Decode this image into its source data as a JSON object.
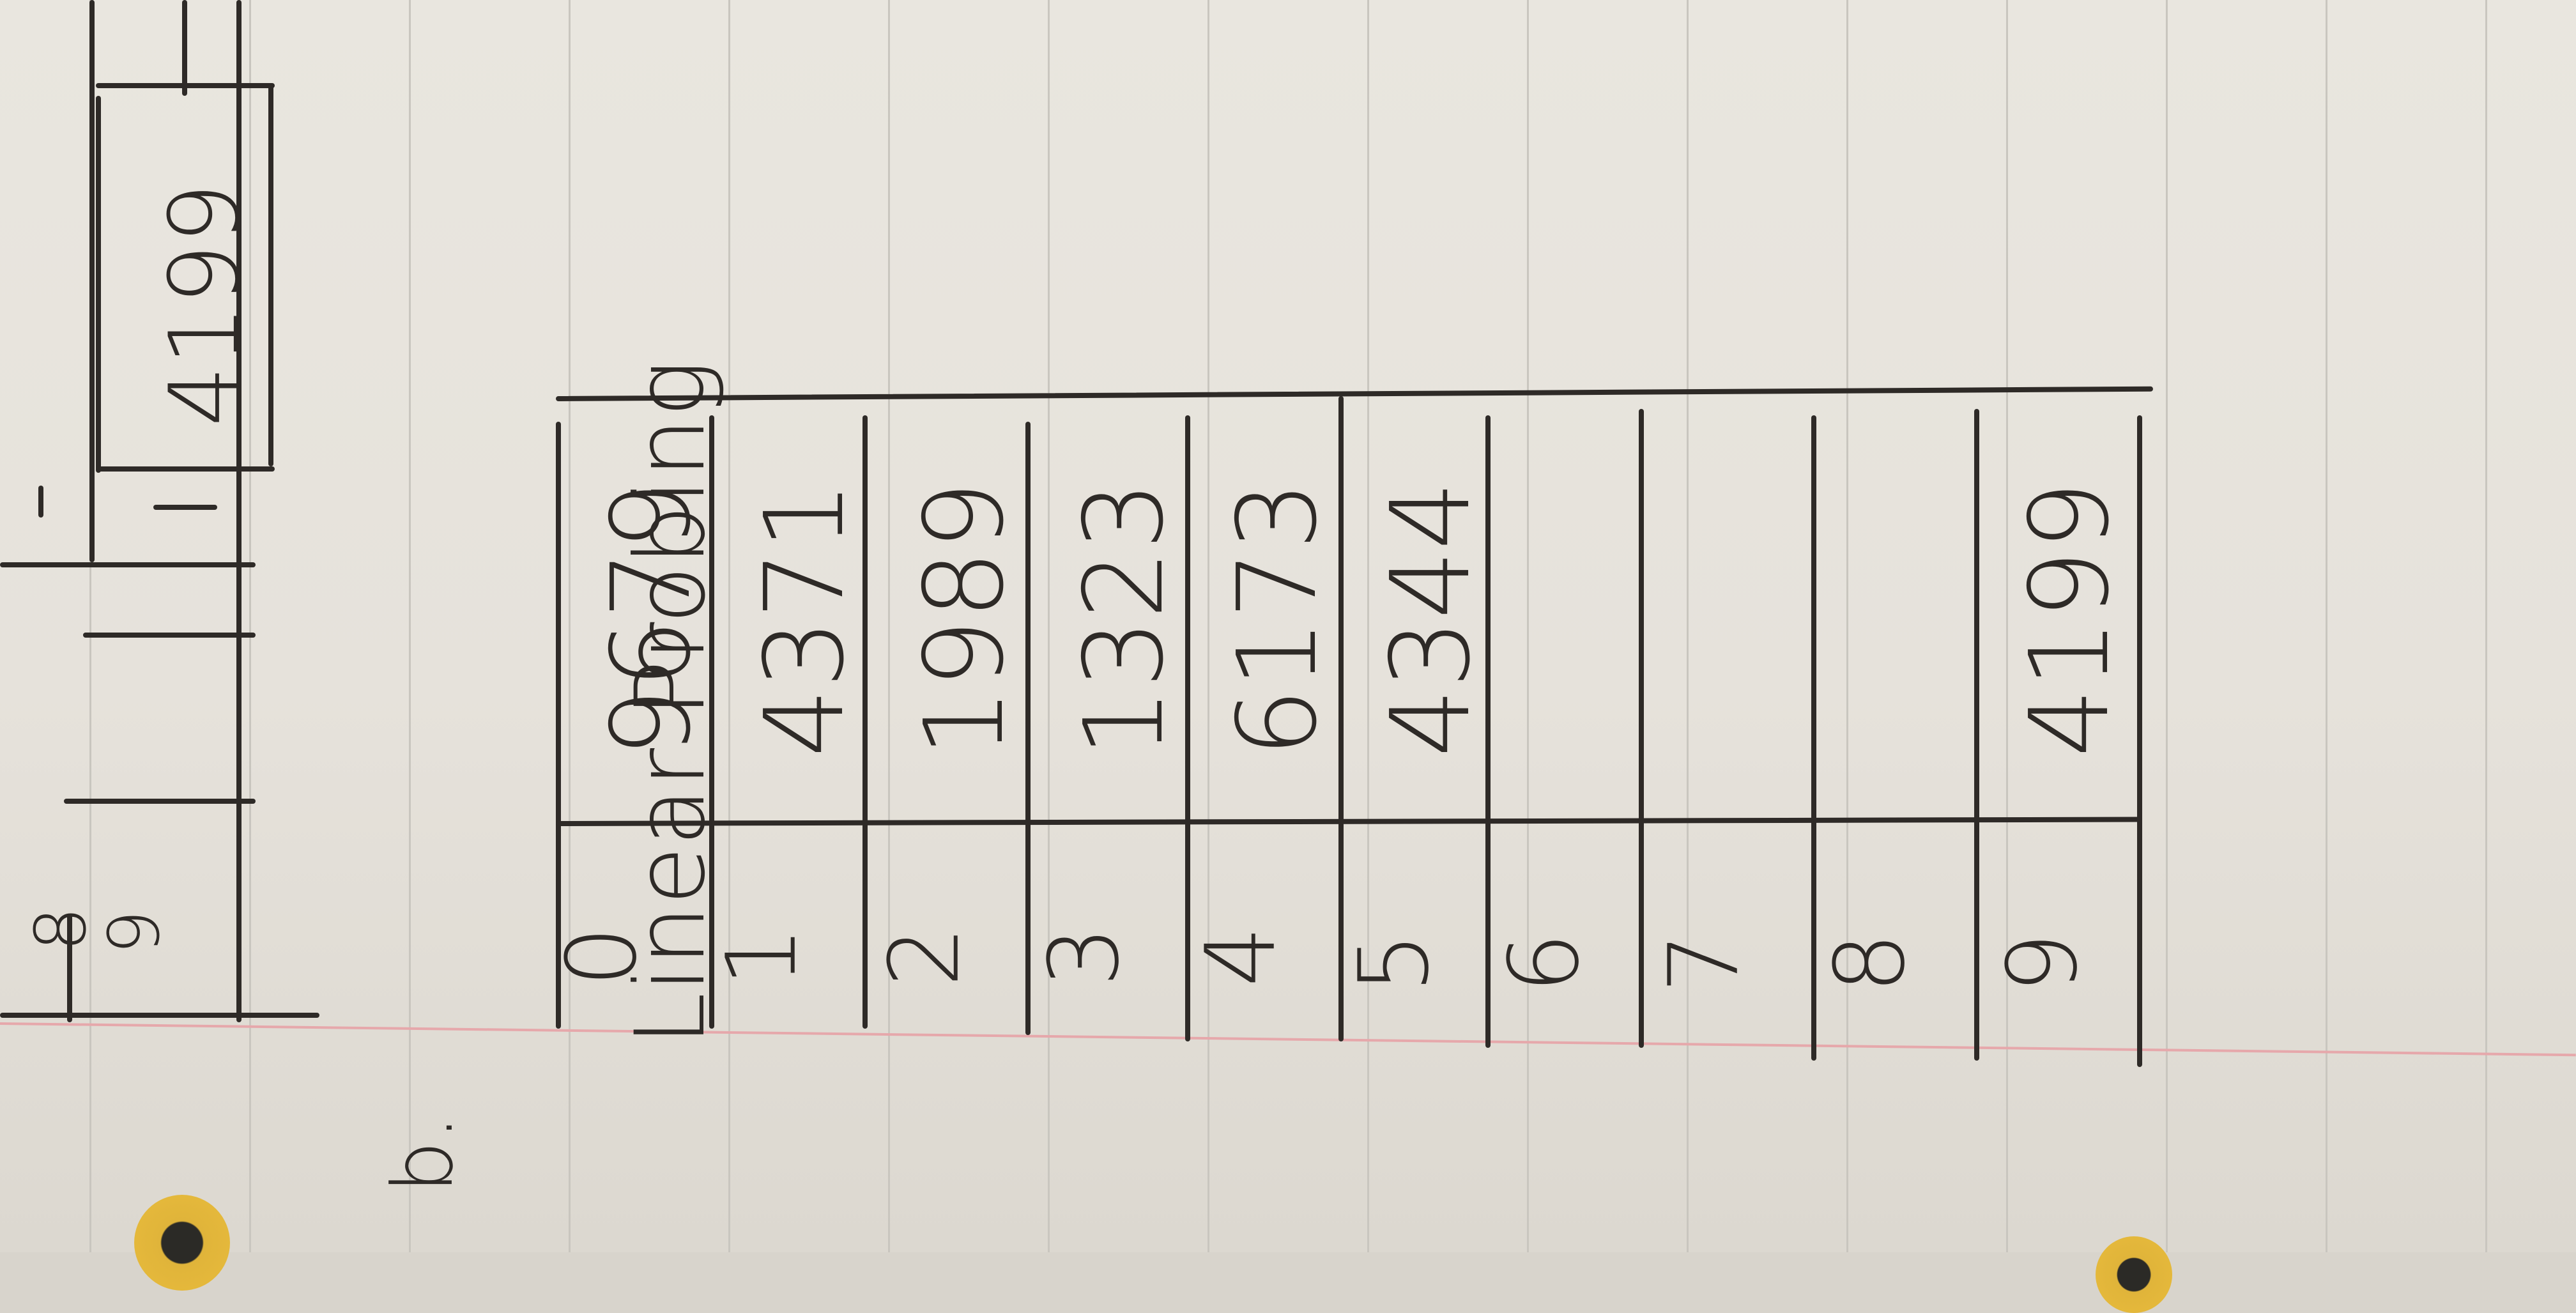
{
  "notebook": {
    "problem_label": "b.",
    "heading": "Linear Probing",
    "top_partial": {
      "indices": [
        "8",
        "9"
      ],
      "chain_value": "4199"
    },
    "table": {
      "rows": [
        {
          "index": "0",
          "value": "9679"
        },
        {
          "index": "1",
          "value": "4371"
        },
        {
          "index": "2",
          "value": "1989"
        },
        {
          "index": "3",
          "value": "1323"
        },
        {
          "index": "4",
          "value": "6173"
        },
        {
          "index": "5",
          "value": "4344"
        },
        {
          "index": "6",
          "value": ""
        },
        {
          "index": "7",
          "value": ""
        },
        {
          "index": "8",
          "value": ""
        },
        {
          "index": "9",
          "value": "4199"
        }
      ]
    }
  }
}
